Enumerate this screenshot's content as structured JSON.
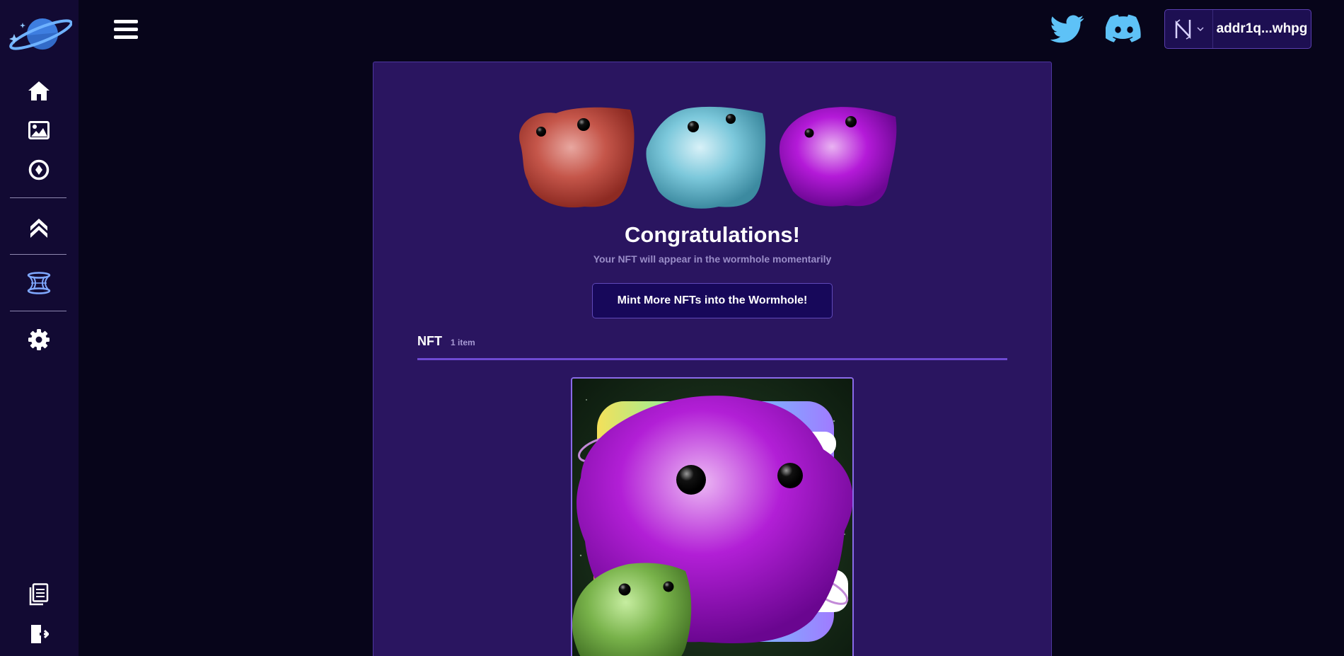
{
  "header": {
    "wallet_address": "addr1q...whpg",
    "icons": [
      "twitter-icon",
      "discord-icon",
      "wallet-logo-icon",
      "chevron-down-icon"
    ]
  },
  "sidebar": {
    "items": [
      {
        "icon": "home-icon"
      },
      {
        "icon": "image-icon"
      },
      {
        "icon": "compass-icon"
      },
      {
        "icon": "double-chevron-up-icon"
      },
      {
        "icon": "wormhole-icon"
      },
      {
        "icon": "gear-icon"
      },
      {
        "icon": "document-icon"
      },
      {
        "icon": "logout-icon"
      }
    ]
  },
  "main": {
    "title": "Congratulations!",
    "subtitle": "Your NFT will appear in the wormhole momentarily",
    "mint_button": "Mint More NFTs into the Wormhole!",
    "section": {
      "title": "NFT",
      "count": "1 item"
    }
  },
  "colors": {
    "background": "#07051a",
    "sidebar": "#120a33",
    "card": "#2a1560",
    "accent": "#6e4ad2",
    "twitter": "#5ec2f7",
    "discord": "#5ec2f7"
  }
}
